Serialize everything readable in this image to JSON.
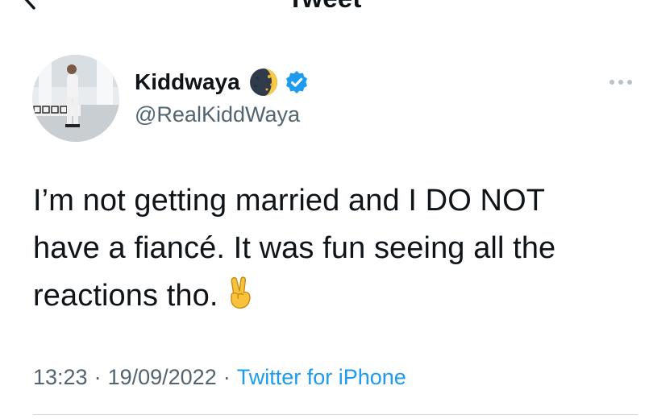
{
  "header": {
    "title": "Tweet",
    "back_icon": "arrow-left-icon"
  },
  "author": {
    "display_name": "Kiddwaya",
    "handle": "@RealKiddWaya",
    "badges": [
      "moon-emoji-icon",
      "verified-badge-icon"
    ],
    "verified_color": "#1d9bf0"
  },
  "more_icon": "more-dots-icon",
  "tweet": {
    "lines": [
      "I’m not getting married and I DO NOT",
      "have a fiancé. It was fun seeing all the",
      "reactions tho."
    ],
    "emoji": "victory-hand-icon"
  },
  "meta": {
    "time": "13:23",
    "separator": "·",
    "date": "19/09/2022",
    "source": "Twitter for iPhone"
  },
  "colors": {
    "text_primary": "#0f1419",
    "text_secondary": "#536471",
    "link": "#1d9bf0",
    "divider": "#cfd9de"
  }
}
